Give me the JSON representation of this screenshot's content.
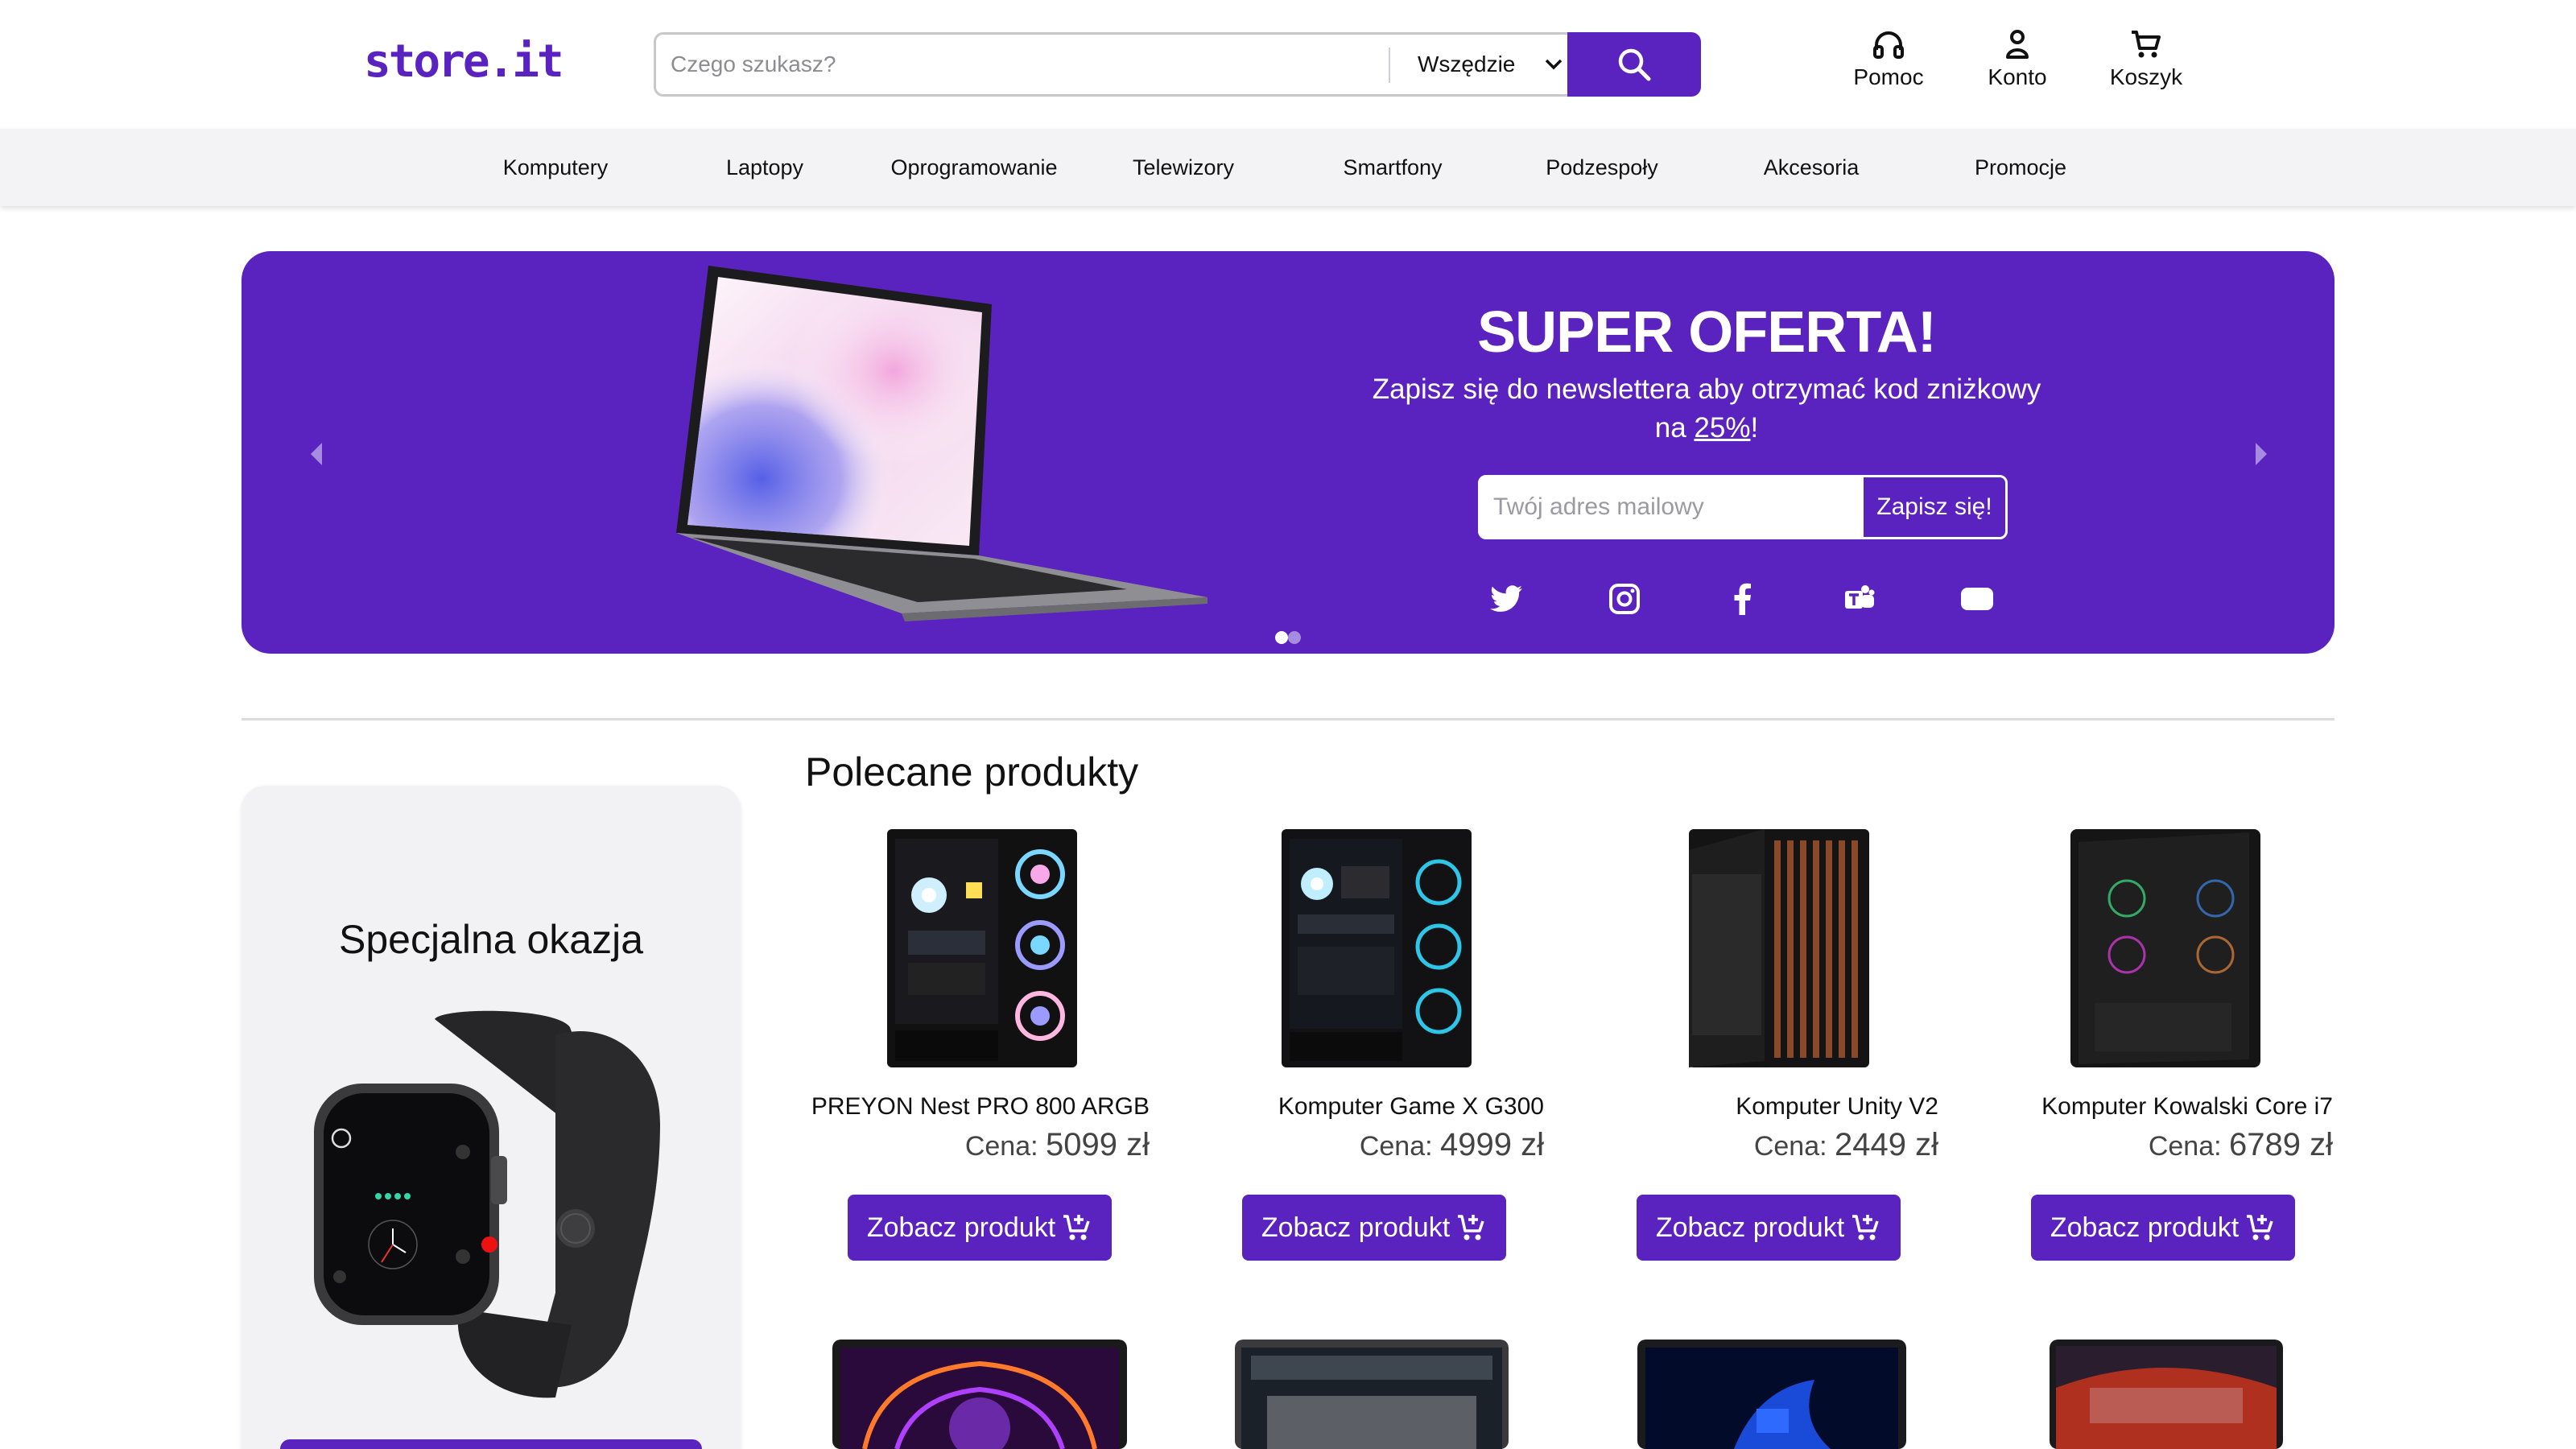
{
  "header": {
    "logo": "store.it",
    "search_placeholder": "Czego szukasz?",
    "search_scope": "Wszędzie",
    "links": {
      "help": "Pomoc",
      "account": "Konto",
      "cart": "Koszyk"
    }
  },
  "nav": {
    "items": [
      "Komputery",
      "Laptopy",
      "Oprogramowanie",
      "Telewizory",
      "Smartfony",
      "Podzespoły",
      "Akcesoria",
      "Promocje"
    ]
  },
  "hero": {
    "title": "SUPER OFERTA!",
    "text_before": "Zapisz się do newslettera aby otrzymać kod zniżkowy na ",
    "discount": "25%",
    "text_after": "!",
    "email_placeholder": "Twój adres mailowy",
    "subscribe_label": "Zapisz się!",
    "social_icons": [
      "twitter-icon",
      "instagram-icon",
      "facebook-icon",
      "teams-icon",
      "youtube-icon"
    ],
    "slides": 2,
    "active_slide": 1
  },
  "special": {
    "title": "Specjalna okazja"
  },
  "products": {
    "title": "Polecane produkty",
    "price_prefix": "Cena:",
    "button_label": "Zobacz produkt",
    "items": [
      {
        "name": "PREYON Nest PRO 800 ARGB",
        "price": "5099 zł"
      },
      {
        "name": "Komputer Game X G300",
        "price": "4999 zł"
      },
      {
        "name": "Komputer Unity V2",
        "price": "2449 zł"
      },
      {
        "name": "Komputer Kowalski Core i7",
        "price": "6789 zł"
      }
    ]
  },
  "colors": {
    "accent": "#5a22bf",
    "nav_bg": "#f3f3f5",
    "card_bg": "#f2f2f4"
  }
}
